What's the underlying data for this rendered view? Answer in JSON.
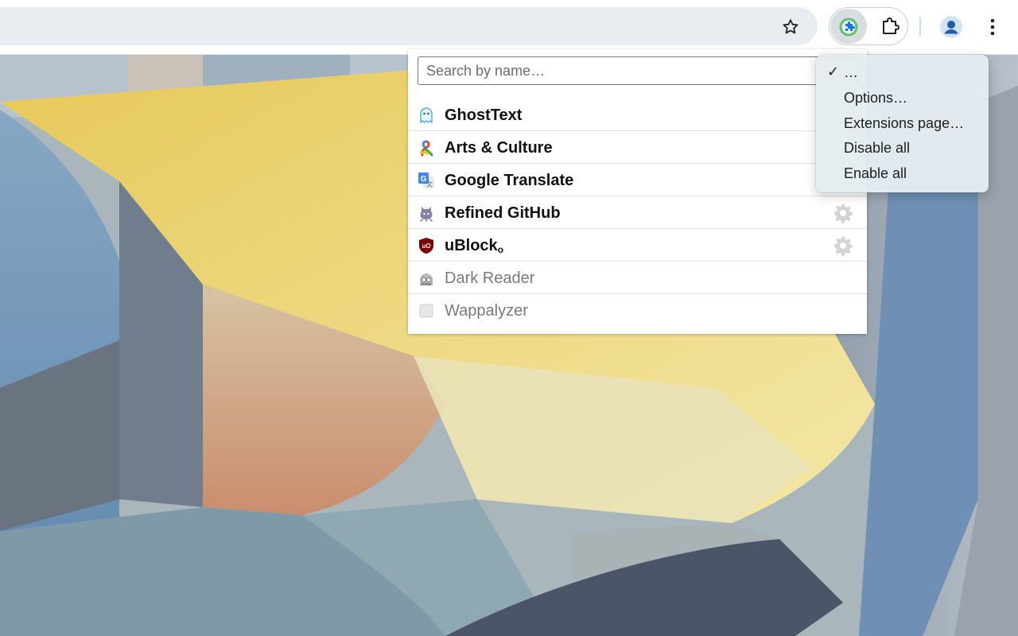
{
  "toolbar": {
    "bookmark_icon": "star-icon",
    "active_extension_icon": "extension-manager-icon",
    "extensions_icon": "puzzle-icon",
    "profile_icon": "profile-icon",
    "menu_icon": "more-vert-icon"
  },
  "popup": {
    "search_placeholder": "Search by name…",
    "extensions": [
      {
        "name": "GhostText",
        "enabled": true,
        "icon": "ghost-icon",
        "has_options": false
      },
      {
        "name": "Arts & Culture",
        "enabled": true,
        "icon": "arts-culture-icon",
        "has_options": false
      },
      {
        "name": "Google Translate",
        "enabled": true,
        "icon": "translate-icon",
        "has_options": false
      },
      {
        "name": "Refined GitHub",
        "enabled": true,
        "icon": "octocat-icon",
        "has_options": true
      },
      {
        "name": "uBlock",
        "name_suffix": "o",
        "enabled": true,
        "icon": "shield-icon",
        "has_options": true
      },
      {
        "name": "Dark Reader",
        "enabled": false,
        "icon": "dark-reader-icon",
        "has_options": false
      },
      {
        "name": "Wappalyzer",
        "enabled": false,
        "icon": "wappalyzer-icon",
        "has_options": false
      }
    ]
  },
  "context_menu": {
    "items": [
      {
        "label": "…",
        "checked": true
      },
      {
        "label": "Options…",
        "checked": false
      },
      {
        "label": "Extensions page…",
        "checked": false
      },
      {
        "label": "Disable all",
        "checked": false
      },
      {
        "label": "Enable all",
        "checked": false
      }
    ],
    "check_mark": "✓"
  },
  "colors": {
    "accent_green": "#4caf50",
    "accent_blue": "#1a73e8"
  }
}
